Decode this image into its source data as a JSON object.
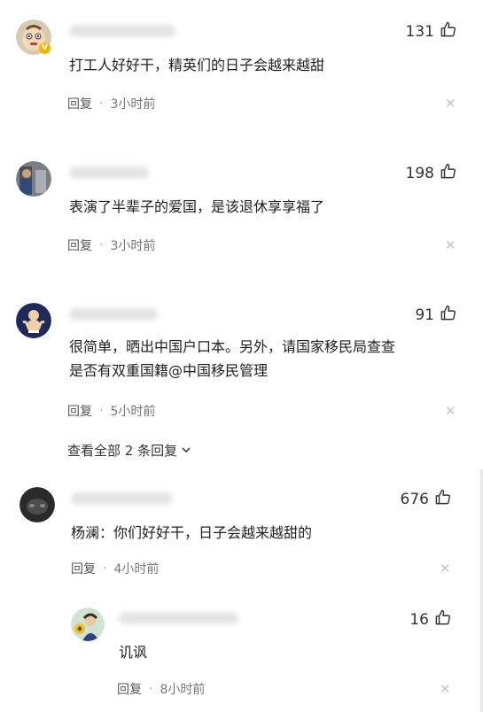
{
  "comments": [
    {
      "likes": "131",
      "text": "打工人好好干，精英们的日子会越来越甜",
      "reply_label": "回复",
      "time": "3小时前",
      "avatar_icon": "cartoon-avatar-icon",
      "verified_badge": "V"
    },
    {
      "likes": "198",
      "text": "表演了半辈子的爱国，是该退休享享福了",
      "reply_label": "回复",
      "time": "3小时前",
      "avatar_icon": "photo-avatar-icon"
    },
    {
      "likes": "91",
      "text_line1": "很简单，晒出中国户口本。另外，请国家移民局查查",
      "text_line2": "是否有双重国籍@中国移民管理",
      "reply_label": "回复",
      "time": "5小时前",
      "avatar_icon": "baby-avatar-icon",
      "view_all": "查看全部 2 条回复"
    },
    {
      "likes": "676",
      "text": "杨澜：你们好好干，日子会越来越甜的",
      "reply_label": "回复",
      "time": "4小时前",
      "avatar_icon": "dark-avatar-icon"
    },
    {
      "likes": "16",
      "text": "讥讽",
      "reply_label": "回复",
      "time": "8小时前",
      "avatar_icon": "flower-avatar-icon"
    }
  ],
  "colors": {
    "text": "#1f1f1f",
    "meta": "#555555",
    "close": "#c4c4c4"
  }
}
